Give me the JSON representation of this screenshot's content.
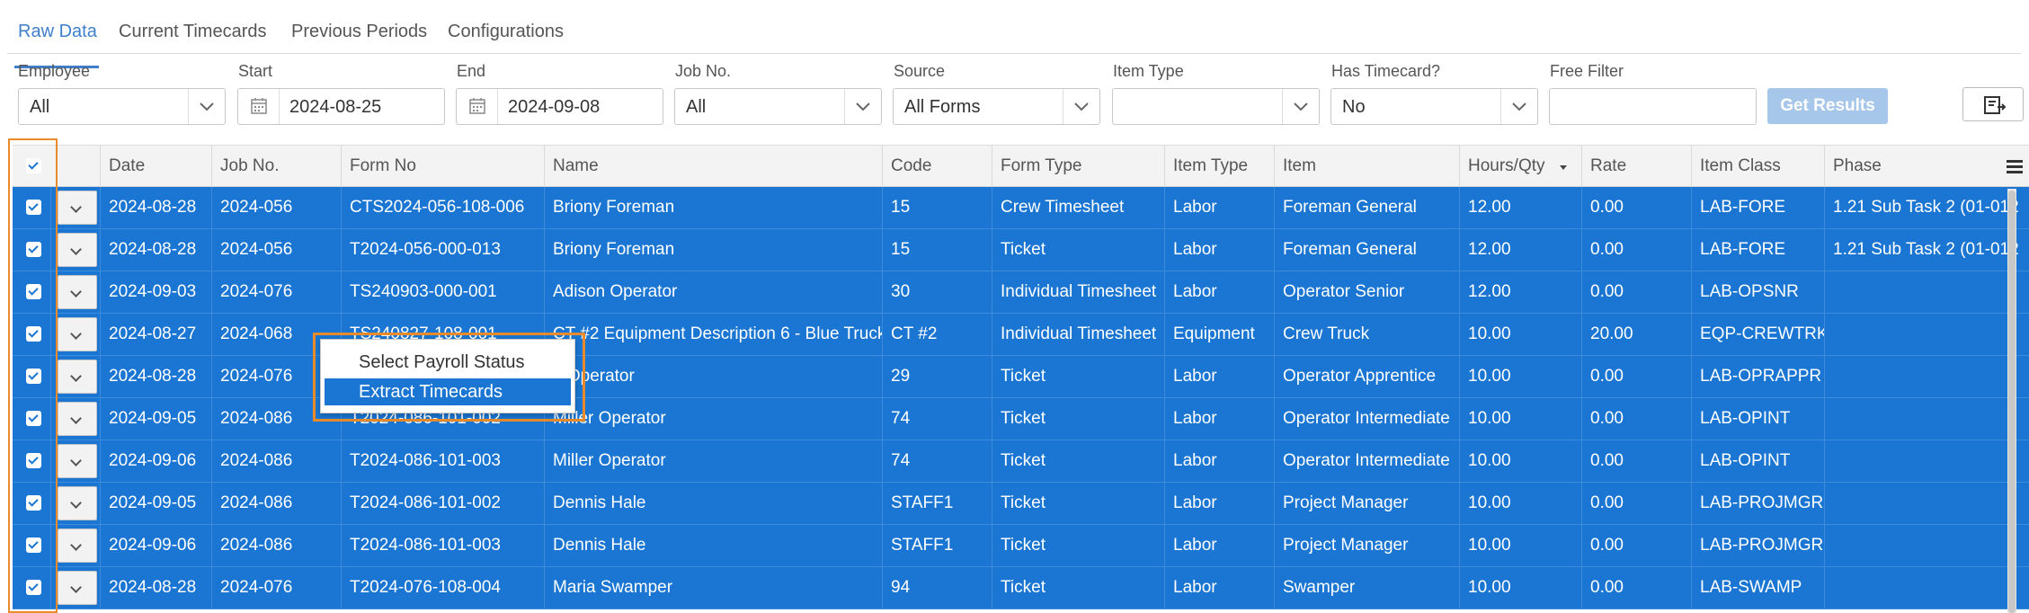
{
  "tabs": [
    "Raw Data",
    "Current Timecards",
    "Previous Periods",
    "Configurations"
  ],
  "filters": {
    "employee": {
      "label": "Employee",
      "value": "All"
    },
    "start": {
      "label": "Start",
      "value": "2024-08-25"
    },
    "end": {
      "label": "End",
      "value": "2024-09-08"
    },
    "job_no": {
      "label": "Job No.",
      "value": "All"
    },
    "source": {
      "label": "Source",
      "value": "All Forms"
    },
    "item_type": {
      "label": "Item Type",
      "value": ""
    },
    "has_timecard": {
      "label": "Has Timecard?",
      "value": "No"
    },
    "free_filter": {
      "label": "Free Filter",
      "value": ""
    },
    "get_results": "Get Results"
  },
  "columns": [
    "Date",
    "Job No.",
    "Form No",
    "Name",
    "Code",
    "Form Type",
    "Item Type",
    "Item",
    "Hours/Qty",
    "Rate",
    "Item Class",
    "Phase"
  ],
  "rows": [
    [
      "2024-08-28",
      "2024-056",
      "CTS2024-056-108-006",
      "Briony Foreman",
      "15",
      "Crew Timesheet",
      "Labor",
      "Foreman General",
      "12.00",
      "0.00",
      "LAB-FORE",
      "1.21 Sub Task 2 (01-012"
    ],
    [
      "2024-08-28",
      "2024-056",
      "T2024-056-000-013",
      "Briony Foreman",
      "15",
      "Ticket",
      "Labor",
      "Foreman General",
      "12.00",
      "0.00",
      "LAB-FORE",
      "1.21 Sub Task 2 (01-012"
    ],
    [
      "2024-09-03",
      "2024-076",
      "TS240903-000-001",
      "Adison Operator",
      "30",
      "Individual Timesheet",
      "Labor",
      "Operator Senior",
      "12.00",
      "0.00",
      "LAB-OPSNR",
      ""
    ],
    [
      "2024-08-27",
      "2024-068",
      "TS240827-108-001",
      "CT #2 Equipment Description 6 - Blue Truck",
      "CT #2",
      "Individual Timesheet",
      "Equipment",
      "Crew Truck",
      "10.00",
      "20.00",
      "EQP-CREWTRK",
      ""
    ],
    [
      "2024-08-28",
      "2024-076",
      "",
      "a Operator",
      "29",
      "Ticket",
      "Labor",
      "Operator Apprentice",
      "10.00",
      "0.00",
      "LAB-OPRAPPR",
      ""
    ],
    [
      "2024-09-05",
      "2024-086",
      "T2024-086-101-002",
      "Miller Operator",
      "74",
      "Ticket",
      "Labor",
      "Operator Intermediate",
      "10.00",
      "0.00",
      "LAB-OPINT",
      ""
    ],
    [
      "2024-09-06",
      "2024-086",
      "T2024-086-101-003",
      "Miller Operator",
      "74",
      "Ticket",
      "Labor",
      "Operator Intermediate",
      "10.00",
      "0.00",
      "LAB-OPINT",
      ""
    ],
    [
      "2024-09-05",
      "2024-086",
      "T2024-086-101-002",
      "Dennis Hale",
      "STAFF1",
      "Ticket",
      "Labor",
      "Project Manager",
      "10.00",
      "0.00",
      "LAB-PROJMGR",
      ""
    ],
    [
      "2024-09-06",
      "2024-086",
      "T2024-086-101-003",
      "Dennis Hale",
      "STAFF1",
      "Ticket",
      "Labor",
      "Project Manager",
      "10.00",
      "0.00",
      "LAB-PROJMGR",
      ""
    ],
    [
      "2024-08-28",
      "2024-076",
      "T2024-076-108-004",
      "Maria Swamper",
      "94",
      "Ticket",
      "Labor",
      "Swamper",
      "10.00",
      "0.00",
      "LAB-SWAMP",
      ""
    ]
  ],
  "context_menu": {
    "items": [
      "Select Payroll Status",
      "Extract Timecards"
    ],
    "highlighted": "Extract Timecards"
  },
  "colors": {
    "accent": "#3f7fcb",
    "selected_row": "#1a76d2",
    "highlight_outline": "#e98b2a"
  },
  "icons": {
    "chevron": "chevron-down-icon",
    "calendar": "calendar-icon",
    "sort": "sort-desc-icon",
    "menu": "hamburger-menu-icon",
    "export": "export-icon"
  }
}
